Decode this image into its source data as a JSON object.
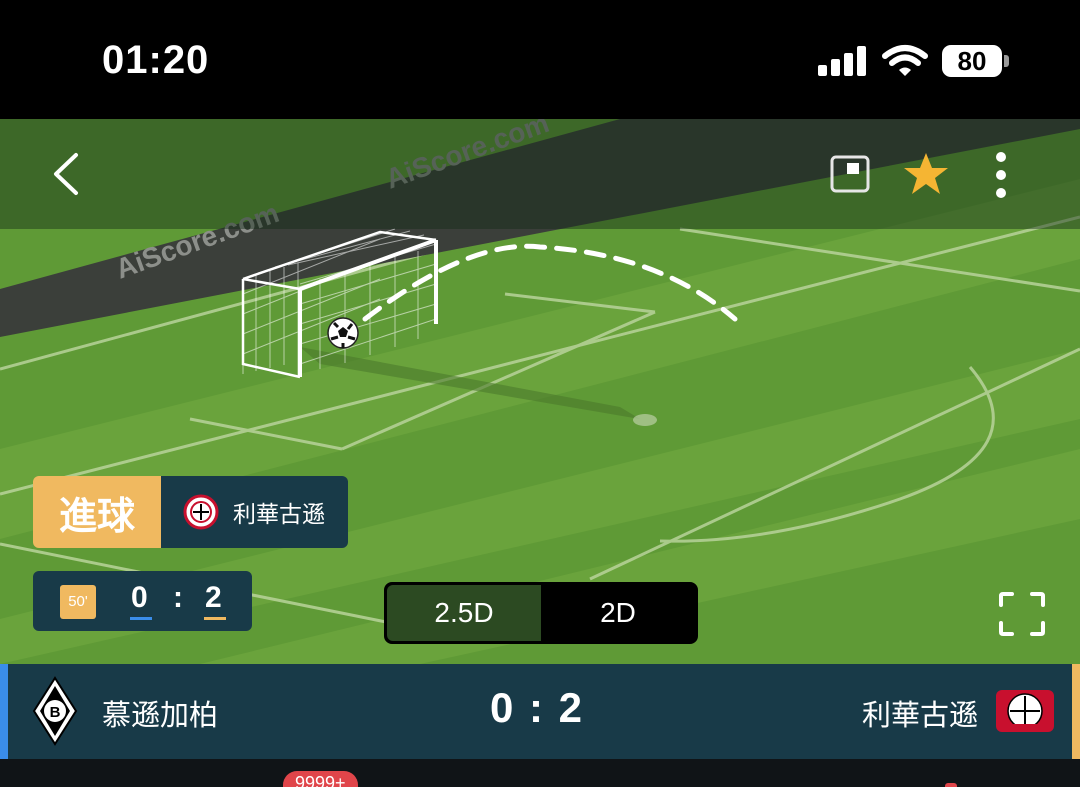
{
  "status_bar": {
    "time": "01:20",
    "battery": "80"
  },
  "pitch": {
    "watermark": "AiScore.com",
    "event": {
      "type": "進球",
      "team": "利華古遜"
    },
    "mini_score": {
      "minute": "50'",
      "home": "0",
      "separator": ":",
      "away": "2"
    },
    "view_toggle": {
      "options": [
        "2.5D",
        "2D"
      ],
      "selected": "2.5D"
    }
  },
  "team_bar": {
    "home_team": "慕遜加柏",
    "away_team": "利華古遜",
    "score": "0 : 2"
  },
  "bottom": {
    "badge": "9999+"
  },
  "icons": {
    "back": "chevron-left-icon",
    "pip": "picture-in-picture-icon",
    "favorite": "star-icon",
    "more": "more-vertical-icon",
    "fullscreen": "fullscreen-icon"
  },
  "colors": {
    "home_accent": "#3a8dea",
    "away_accent": "#f0b960",
    "card_bg": "#183a48",
    "pitch": "#5f9a36",
    "favorite": "#f5b533",
    "badge": "#e0454a"
  }
}
